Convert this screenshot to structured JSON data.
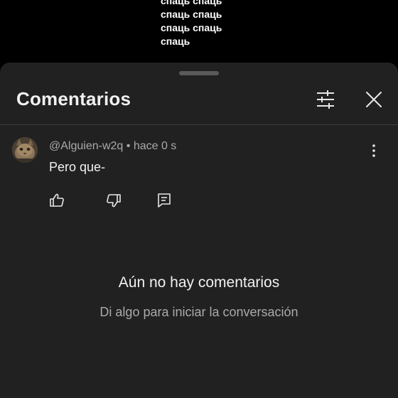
{
  "video": {
    "caption_lines": [
      "спаць спаць",
      "спаць спаць",
      "спаць спаць",
      "спаць"
    ]
  },
  "comments_sheet": {
    "title": "Comentarios",
    "filter_icon": "tune-icon",
    "close_icon": "close-icon"
  },
  "comment": {
    "author": "@Alguien-w2q",
    "separator": "•",
    "time": "hace 0 s",
    "text": "Pero que-",
    "actions": {
      "like_icon": "thumb-up-icon",
      "dislike_icon": "thumb-down-icon",
      "reply_icon": "reply-icon",
      "more_icon": "more-vertical-icon"
    }
  },
  "empty_state": {
    "title": "Aún no hay comentarios",
    "subtitle": "Di algo para iniciar la conversación"
  },
  "colors": {
    "sheet_background": "#212121",
    "text_primary": "#f1f1f1",
    "text_secondary": "#aaaaaa",
    "page_background": "#000000"
  }
}
